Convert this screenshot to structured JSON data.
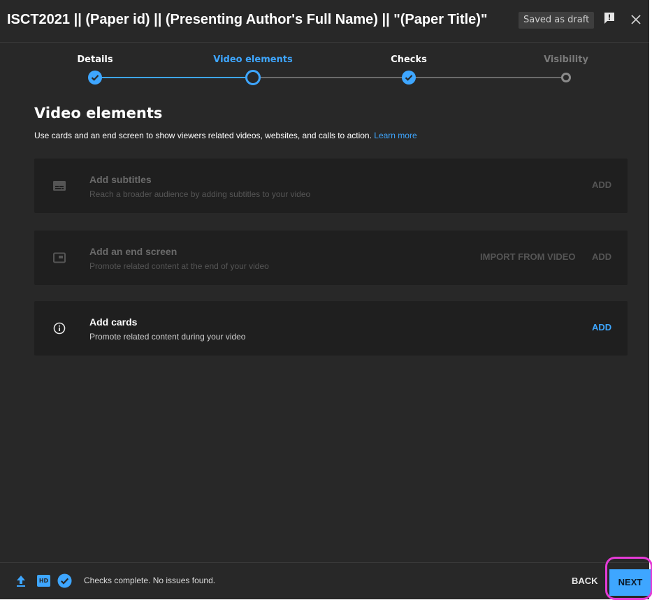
{
  "header": {
    "title": "ISCT2021 || (Paper id) || (Presenting Author's Full Name) || \"(Paper Title)\"",
    "draft_label": "Saved as draft"
  },
  "steps": [
    {
      "label": "Details",
      "state": "done"
    },
    {
      "label": "Video elements",
      "state": "current"
    },
    {
      "label": "Checks",
      "state": "done"
    },
    {
      "label": "Visibility",
      "state": "upcoming"
    }
  ],
  "main": {
    "heading": "Video elements",
    "description": "Use cards and an end screen to show viewers related videos, websites, and calls to action.",
    "learn_more": "Learn more"
  },
  "cards": [
    {
      "title": "Add subtitles",
      "subtitle": "Reach a broader audience by adding subtitles to your video",
      "add_label": "ADD",
      "icon": "subtitles-icon",
      "enabled": false
    },
    {
      "title": "Add an end screen",
      "subtitle": "Promote related content at the end of your video",
      "import_label": "IMPORT FROM VIDEO",
      "add_label": "ADD",
      "icon": "end-screen-icon",
      "enabled": false
    },
    {
      "title": "Add cards",
      "subtitle": "Promote related content during your video",
      "add_label": "ADD",
      "icon": "info-icon",
      "enabled": true
    }
  ],
  "footer": {
    "hd_label": "HD",
    "status": "Checks complete. No issues found.",
    "back_label": "BACK",
    "next_label": "NEXT"
  },
  "colors": {
    "accent": "#3ea6ff",
    "background": "#282828",
    "card_bg": "#1f1f1f",
    "highlight_ring": "#e43bd6"
  }
}
